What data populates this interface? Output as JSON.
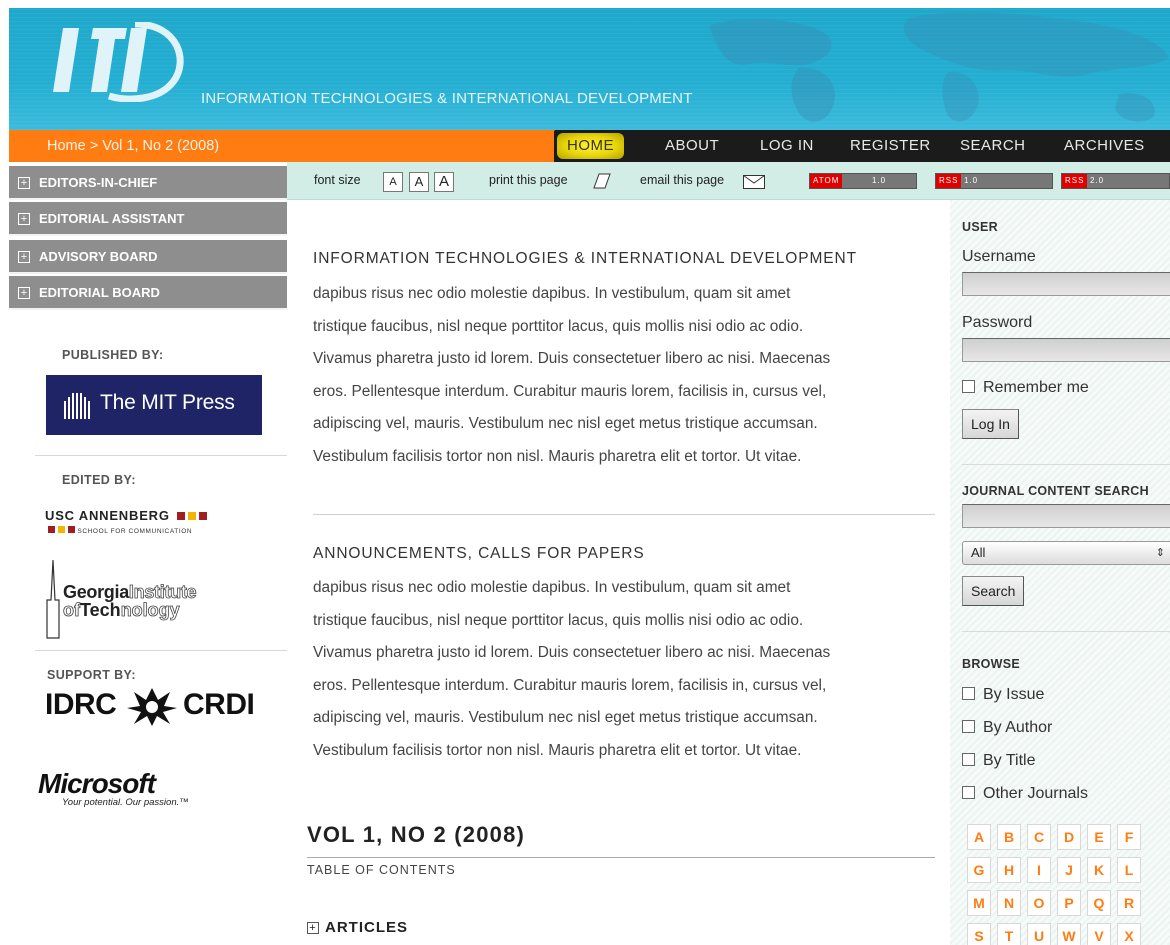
{
  "header": {
    "logo_text": "ITI",
    "site_title": "INFORMATION TECHNOLOGIES & INTERNATIONAL DEVELOPMENT"
  },
  "nav": {
    "breadcrumb": "Home > Vol 1, No 2 (2008)",
    "items": [
      {
        "label": "HOME",
        "active": true
      },
      {
        "label": "ABOUT"
      },
      {
        "label": "LOG IN"
      },
      {
        "label": "REGISTER"
      },
      {
        "label": "SEARCH"
      },
      {
        "label": "ARCHIVES"
      }
    ]
  },
  "left_menu": [
    "EDITORS-IN-CHIEF",
    "EDITORIAL ASSISTANT",
    "ADVISORY BOARD",
    "EDITORIAL BOARD"
  ],
  "sidebar_left": {
    "published_by": "PUBLISHED BY:",
    "edited_by": "EDITED BY:",
    "support_by": "SUPPORT BY:",
    "mit_press": "The MIT Press",
    "usc_main": "USC ANNENBERG",
    "usc_sub": "SCHOOL FOR COMMUNICATION",
    "georgia_1a": "Georgia",
    "georgia_1b": "Institute",
    "georgia_2a": "of",
    "georgia_2b": "Tech",
    "georgia_2c": "nology",
    "idrc": "IDRC",
    "crdi": "CRDI",
    "microsoft": "Microsoft",
    "microsoft_tag": "Your potential. Our passion.™"
  },
  "toolbar": {
    "font_size_label": "font size",
    "font_sizes": [
      "A",
      "A",
      "A"
    ],
    "print_label": "print this page",
    "email_label": "email this page",
    "feeds": [
      {
        "key": "ATOM",
        "version": "1.0"
      },
      {
        "key": "RSS",
        "version": "1.0"
      },
      {
        "key": "RSS",
        "version": "2.0"
      }
    ]
  },
  "main": {
    "section1_title": "INFORMATION TECHNOLOGIES & INTERNATIONAL DEVELOPMENT",
    "section1_lines": [
      "dapibus risus nec odio molestie dapibus. In vestibulum, quam sit amet",
      "tristique faucibus, nisl neque porttitor lacus, quis mollis nisi odio ac odio.",
      "Vivamus pharetra justo id lorem. Duis consectetuer libero ac nisi. Maecenas",
      "eros. Pellentesque interdum. Curabitur mauris lorem, facilisis in, cursus vel,",
      "adipiscing vel, mauris. Vestibulum nec nisl eget metus tristique accumsan.",
      "Vestibulum facilisis tortor non nisl. Mauris pharetra elit et tortor. Ut vitae."
    ],
    "section2_title": "ANNOUNCEMENTS, CALLS FOR PAPERS",
    "section2_lines": [
      "dapibus risus nec odio molestie dapibus. In vestibulum, quam sit amet",
      "tristique faucibus, nisl neque porttitor lacus, quis mollis nisi odio ac odio.",
      "Vivamus pharetra justo id lorem. Duis consectetuer libero ac nisi. Maecenas",
      "eros. Pellentesque interdum. Curabitur mauris lorem, facilisis in, cursus vel,",
      "adipiscing vel, mauris. Vestibulum nec nisl eget metus tristique accumsan.",
      "Vestibulum facilisis tortor non nisl. Mauris pharetra elit et tortor. Ut vitae."
    ],
    "volume_title": "VOL 1, NO 2 (2008)",
    "toc_label": "TABLE OF CONTENTS",
    "articles_label": "ARTICLES"
  },
  "sidebar_right": {
    "user_heading": "USER",
    "username_label": "Username",
    "username_value": "",
    "password_label": "Password",
    "password_value": "",
    "remember_label": "Remember me",
    "login_button": "Log In",
    "search_heading": "JOURNAL CONTENT SEARCH",
    "search_value": "",
    "search_scope": "All",
    "search_button": "Search",
    "browse_heading": "BROWSE",
    "browse_items": [
      "By Issue",
      "By Author",
      "By Title",
      "Other Journals"
    ],
    "alphabet": [
      "A",
      "B",
      "C",
      "D",
      "E",
      "F",
      "G",
      "H",
      "I",
      "J",
      "K",
      "L",
      "M",
      "N",
      "O",
      "P",
      "Q",
      "R",
      "S",
      "T",
      "U",
      "W",
      "V",
      "X"
    ]
  },
  "colors": {
    "header_blue": "#23aed2",
    "breadcrumb_orange": "#ff7c12",
    "nav_dark": "#1b1b1b",
    "menu_gray": "#8e8e8e",
    "toolbar_mint": "#d2ece6",
    "alpha_orange": "#ff7c12"
  }
}
